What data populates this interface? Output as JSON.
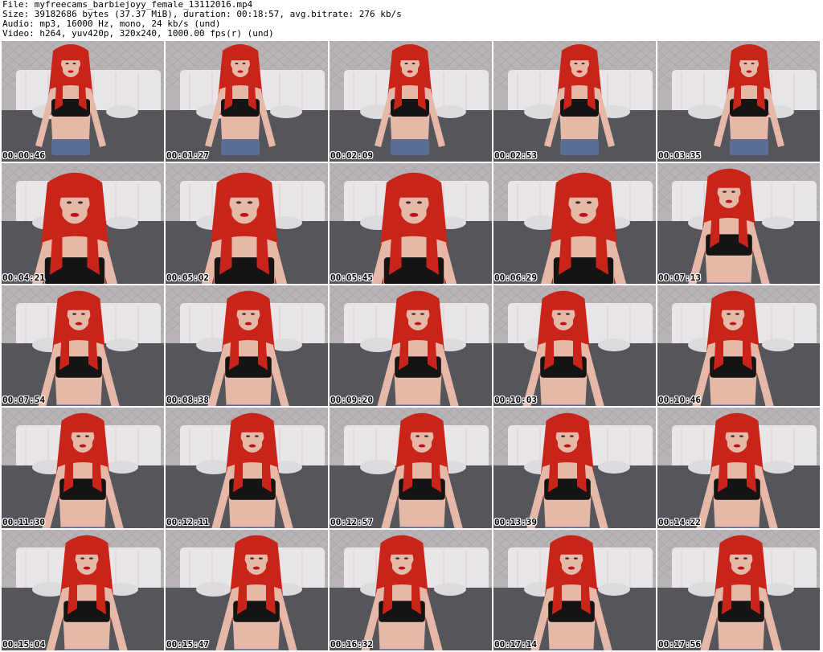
{
  "header": {
    "file_line": "File: myfreecams_barbiejoyy_female_13112016.mp4",
    "size_line": "Size: 39182686 bytes (37.37 MiB), duration: 00:18:57, avg.bitrate: 276 kb/s",
    "audio_line": "Audio: mp3, 16000 Hz, mono, 24 kb/s (und)",
    "video_line": "Video: h264, yuv420p, 320x240, 1000.00 fps(r) (und)"
  },
  "thumbnails": [
    {
      "timestamp": "00:00:46",
      "zoom": "far"
    },
    {
      "timestamp": "00:01:27",
      "zoom": "far"
    },
    {
      "timestamp": "00:02:09",
      "zoom": "far"
    },
    {
      "timestamp": "00:02:53",
      "zoom": "far"
    },
    {
      "timestamp": "00:03:35",
      "zoom": "far"
    },
    {
      "timestamp": "00:04:21",
      "zoom": "close"
    },
    {
      "timestamp": "00:05:02",
      "zoom": "close"
    },
    {
      "timestamp": "00:05:45",
      "zoom": "close"
    },
    {
      "timestamp": "00:06:29",
      "zoom": "close"
    },
    {
      "timestamp": "00:07:13",
      "zoom": "mid"
    },
    {
      "timestamp": "00:07:54",
      "zoom": "mid"
    },
    {
      "timestamp": "00:08:38",
      "zoom": "mid"
    },
    {
      "timestamp": "00:09:20",
      "zoom": "mid"
    },
    {
      "timestamp": "00:10:03",
      "zoom": "mid"
    },
    {
      "timestamp": "00:10:46",
      "zoom": "mid"
    },
    {
      "timestamp": "00:11:30",
      "zoom": "mid"
    },
    {
      "timestamp": "00:12:11",
      "zoom": "mid"
    },
    {
      "timestamp": "00:12:57",
      "zoom": "mid"
    },
    {
      "timestamp": "00:13:39",
      "zoom": "mid"
    },
    {
      "timestamp": "00:14:22",
      "zoom": "mid"
    },
    {
      "timestamp": "00:15:04",
      "zoom": "mid"
    },
    {
      "timestamp": "00:15:47",
      "zoom": "mid"
    },
    {
      "timestamp": "00:16:32",
      "zoom": "mid"
    },
    {
      "timestamp": "00:17:14",
      "zoom": "mid"
    },
    {
      "timestamp": "00:17:56",
      "zoom": "mid"
    }
  ],
  "colors": {
    "wall": "#b8b3b6",
    "headboard": "#e9e6e9",
    "bedding": "#55555c",
    "hair": "#c8241a",
    "skin": "#e6b8a8",
    "top": "#141414",
    "shorts": "#5b6f96",
    "timestamp_text": "#000000",
    "timestamp_outline": "#ffffff"
  }
}
